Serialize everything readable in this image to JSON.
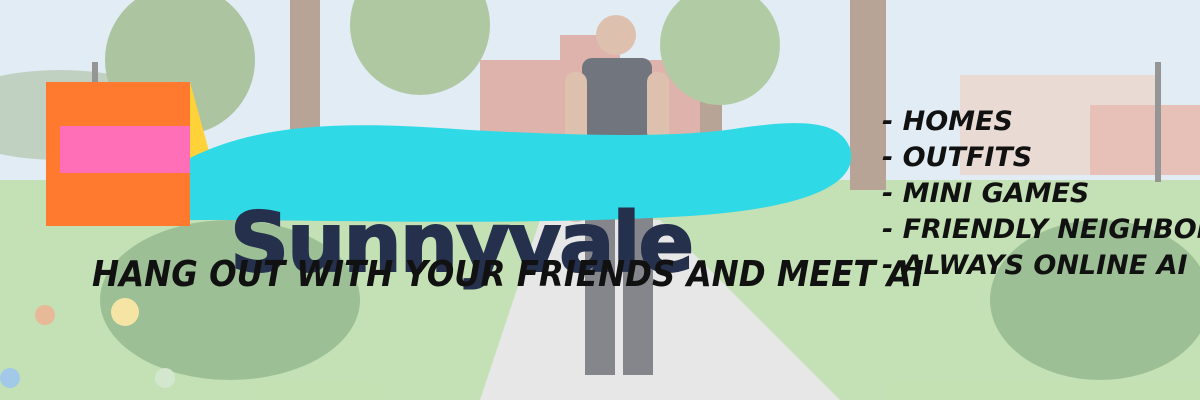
{
  "logo": {
    "word": "Sunnyvale"
  },
  "tagline": "HANG OUT WITH YOUR FRIENDS AND MEET AI",
  "features": [
    "- HOMES",
    "- OUTFITS",
    "- MINI GAMES",
    "- FRIENDLY NEIGHBORS",
    "- ALWAYS ONLINE AI"
  ],
  "colors": {
    "logo_orange": "#ff7a2f",
    "logo_pink": "#ff6fb8",
    "logo_yellow": "#ffd23a",
    "logo_wave": "#2fd9e6",
    "logo_text": "#25304d"
  }
}
